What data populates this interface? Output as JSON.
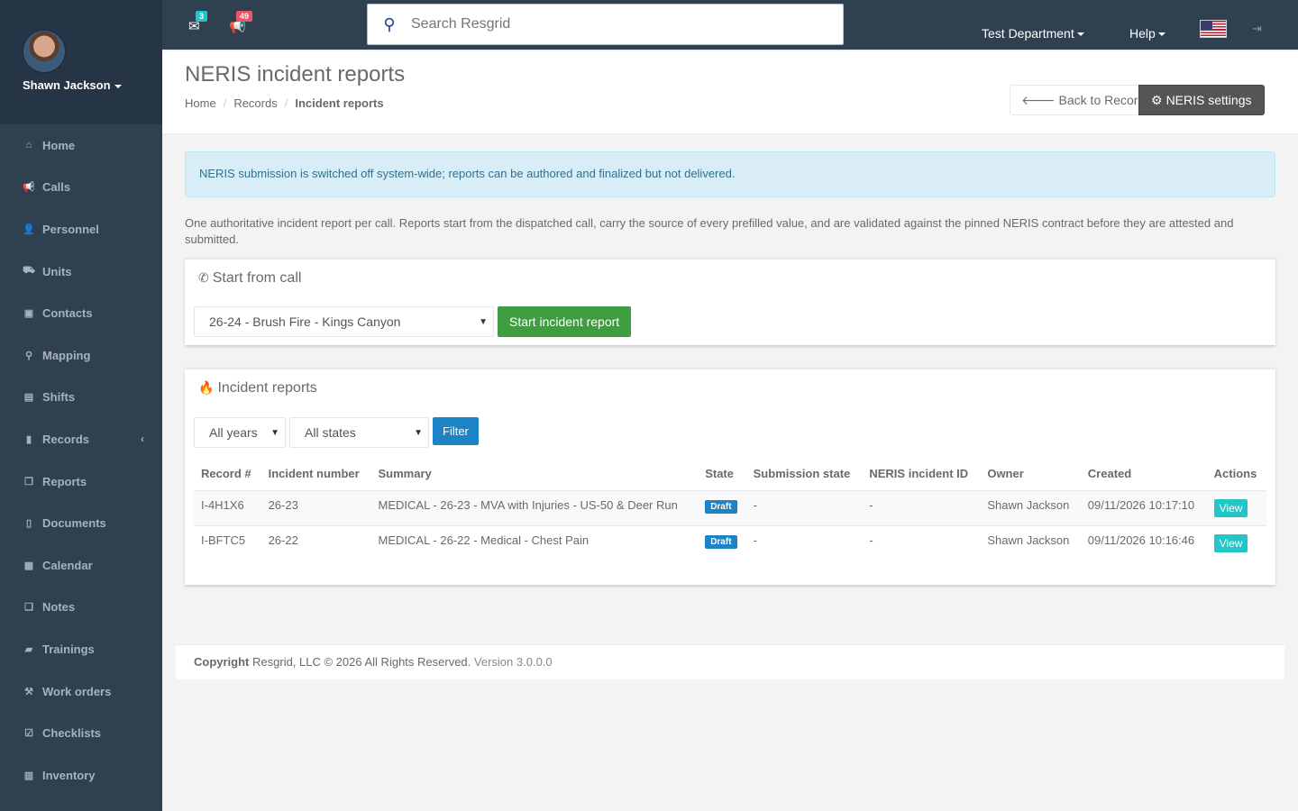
{
  "user": {
    "name": "Shawn Jackson"
  },
  "topbar": {
    "messages_count": "3",
    "calls_count": "49",
    "search_placeholder": "Search Resgrid",
    "department": "Test Department",
    "help": "Help",
    "colors": {
      "messages_badge": "#23c6c8",
      "calls_badge": "#ed5565"
    }
  },
  "sidebar": {
    "items": [
      {
        "label": "Home",
        "icon": "home-icon",
        "glyph": "⌂"
      },
      {
        "label": "Calls",
        "icon": "bullhorn-icon",
        "glyph": "📢"
      },
      {
        "label": "Personnel",
        "icon": "user-icon",
        "glyph": "👤"
      },
      {
        "label": "Units",
        "icon": "road-icon",
        "glyph": "⛟"
      },
      {
        "label": "Contacts",
        "icon": "address-book-icon",
        "glyph": "▣"
      },
      {
        "label": "Mapping",
        "icon": "map-marker-icon",
        "glyph": "⚲"
      },
      {
        "label": "Shifts",
        "icon": "briefcase-icon",
        "glyph": "▤"
      },
      {
        "label": "Records",
        "icon": "file-icon",
        "glyph": "▮"
      },
      {
        "label": "Reports",
        "icon": "copy-icon",
        "glyph": "❐"
      },
      {
        "label": "Documents",
        "icon": "document-icon",
        "glyph": "▯"
      },
      {
        "label": "Calendar",
        "icon": "calendar-icon",
        "glyph": "▦"
      },
      {
        "label": "Notes",
        "icon": "notes-icon",
        "glyph": "❏"
      },
      {
        "label": "Trainings",
        "icon": "book-icon",
        "glyph": "▰"
      },
      {
        "label": "Work orders",
        "icon": "wrench-icon",
        "glyph": "⚒"
      },
      {
        "label": "Checklists",
        "icon": "check-square-icon",
        "glyph": "☑"
      },
      {
        "label": "Inventory",
        "icon": "barcode-icon",
        "glyph": "▥"
      }
    ]
  },
  "heading": {
    "title": "NERIS incident reports",
    "breadcrumb": [
      "Home",
      "Records",
      "Incident reports"
    ],
    "back_button": "Back to Records",
    "settings_button": "NERIS settings"
  },
  "alert": "NERIS submission is switched off system-wide; reports can be authored and finalized but not delivered.",
  "intro": "One authoritative incident report per call. Reports start from the dispatched call, carry the source of every prefilled value, and are validated against the pinned NERIS contract before they are attested and submitted.",
  "start_box": {
    "title": "Start from call",
    "selected_call": "26-24 - Brush Fire - Kings Canyon",
    "start_button": "Start incident report"
  },
  "reports_box": {
    "title": "Incident reports",
    "year_filter": "All years",
    "state_filter": "All states",
    "filter_button": "Filter",
    "columns": [
      "Record #",
      "Incident number",
      "Summary",
      "State",
      "Submission state",
      "NERIS incident ID",
      "Owner",
      "Created",
      "Actions"
    ],
    "rows": [
      {
        "record": "I-4H1X6",
        "incident": "26-23",
        "summary": "MEDICAL - 26-23 - MVA with Injuries - US-50 & Deer Run",
        "state": "Draft",
        "submission": "-",
        "neris_id": "-",
        "owner": "Shawn Jackson",
        "created": "09/11/2026 10:17:10",
        "action": "View"
      },
      {
        "record": "I-BFTC5",
        "incident": "26-22",
        "summary": "MEDICAL - 26-22 - Medical - Chest Pain",
        "state": "Draft",
        "submission": "-",
        "neris_id": "-",
        "owner": "Shawn Jackson",
        "created": "09/11/2026 10:16:46",
        "action": "View"
      }
    ]
  },
  "footer": {
    "copyright_label": "Copyright",
    "copyright_text": "Resgrid, LLC © 2026 All Rights Reserved.",
    "version": "Version 3.0.0.0"
  }
}
